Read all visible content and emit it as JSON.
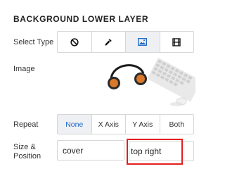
{
  "panel": {
    "title": "BACKGROUND LOWER LAYER"
  },
  "select_type": {
    "label": "Select Type",
    "options": [
      {
        "icon": "none-icon"
      },
      {
        "icon": "eyedropper-icon"
      },
      {
        "icon": "image-icon",
        "active": true
      },
      {
        "icon": "film-icon"
      }
    ]
  },
  "image": {
    "label": "Image"
  },
  "repeat": {
    "label": "Repeat",
    "options": [
      "None",
      "X Axis",
      "Y Axis",
      "Both"
    ],
    "selected": "None"
  },
  "size_position": {
    "label_line1": "Size &",
    "label_line2": "Position",
    "size_value": "cover",
    "position_value": "top right"
  },
  "colors": {
    "active_text": "#1a66c8",
    "highlight_border": "#e41e1e"
  }
}
